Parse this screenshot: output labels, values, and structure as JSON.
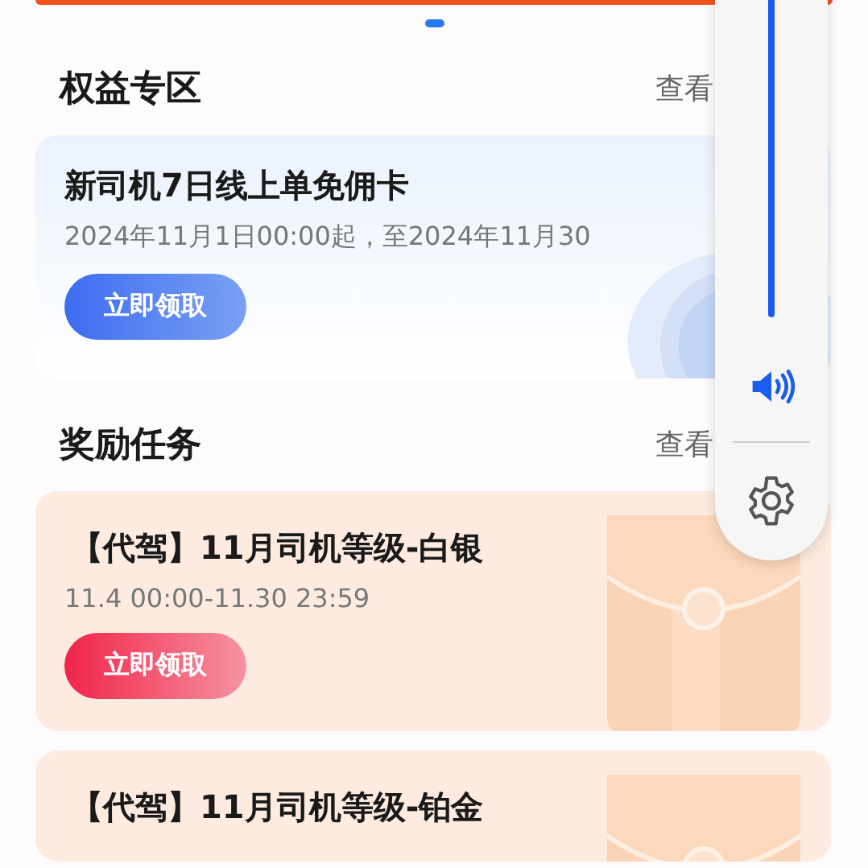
{
  "carousel": {
    "pages": [
      {
        "selected": true
      }
    ]
  },
  "benefits": {
    "title": "权益专区",
    "more": "查看",
    "cards": [
      {
        "title": "新司机7日线上单免佣卡",
        "period": "2024年11月1日00:00起，至2024年11月30",
        "button": "立即领取"
      }
    ]
  },
  "tasks": {
    "title": "奖励任务",
    "more": "查看",
    "cards": [
      {
        "title": "【代驾】11月司机等级-白银",
        "period": "11.4 00:00-11.30 23:59",
        "button": "立即领取"
      },
      {
        "title": "【代驾】11月司机等级-铂金"
      }
    ]
  },
  "volume_panel": {
    "level": 1
  }
}
